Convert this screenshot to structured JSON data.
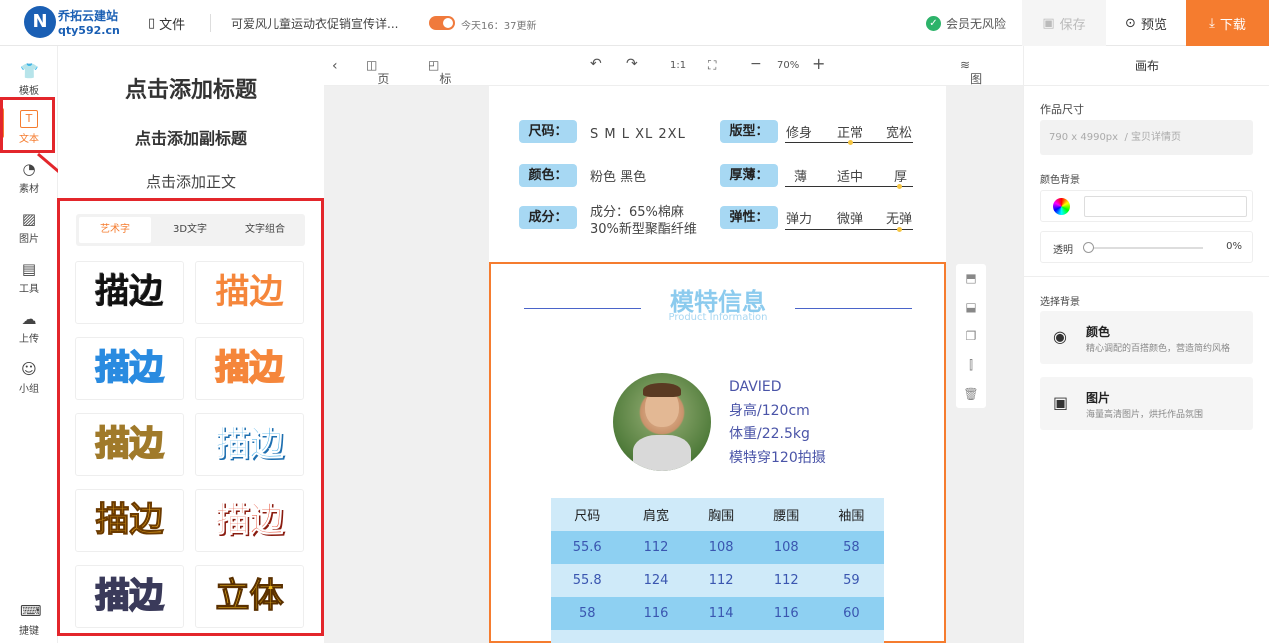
{
  "topbar": {
    "logo_name": "乔拓云建站",
    "logo_url": "qty592.cn",
    "file_label": "文件",
    "doc_title": "可爱风儿童运动衣促销宣传详...",
    "update_time": "今天16：37更新",
    "risk_label": "会员无风险",
    "save_label": "保存",
    "preview_label": "预览",
    "download_label": "下载"
  },
  "leftnav": {
    "items": [
      {
        "label": "模板",
        "icon": "template-icon"
      },
      {
        "label": "文本",
        "icon": "text-icon"
      },
      {
        "label": "素材",
        "icon": "material-icon"
      },
      {
        "label": "图片",
        "icon": "image-icon"
      },
      {
        "label": "工具",
        "icon": "tools-icon"
      },
      {
        "label": "上传",
        "icon": "upload-icon"
      },
      {
        "label": "小组",
        "icon": "group-icon"
      }
    ],
    "shortcut_label": "捷键"
  },
  "text_panel": {
    "add_title": "点击添加标题",
    "add_subtitle": "点击添加副标题",
    "add_body": "点击添加正文",
    "tabs": [
      "艺术字",
      "3D文字",
      "文字组合"
    ],
    "tiles": [
      "描边",
      "描边",
      "描边",
      "描边",
      "描边",
      "描边",
      "描边",
      "描边",
      "描边",
      "立体"
    ]
  },
  "canvas_toolbar": {
    "page_label": "页面",
    "ruler_label": "标尺",
    "ratio": "1:1",
    "zoom": "70%",
    "layers_label": "图层"
  },
  "spec": {
    "size_label": "尺码：",
    "size_value": "S M L XL 2XL",
    "fit_label": "版型：",
    "fit_options": [
      "修身",
      "正常",
      "宽松"
    ],
    "color_label": "颜色：",
    "color_value": "粉色 黑色",
    "thickness_label": "厚薄：",
    "thickness_options": [
      "薄",
      "适中",
      "厚"
    ],
    "material_label": "成分：",
    "material_value_1": "成分：65%棉麻",
    "material_value_2": "30%新型聚酯纤维",
    "elastic_label": "弹性：",
    "elastic_options": [
      "弹力",
      "微弹",
      "无弹"
    ]
  },
  "model": {
    "title": "模特信息",
    "subtitle": "Product Information",
    "name": "DAVIED",
    "height": "身高/120cm",
    "weight": "体重/22.5kg",
    "size_note": "模特穿120拍摄",
    "table_headers": [
      "尺码",
      "肩宽",
      "胸围",
      "腰围",
      "袖围"
    ],
    "table_rows": [
      [
        "55.6",
        "112",
        "108",
        "108",
        "58"
      ],
      [
        "55.8",
        "124",
        "112",
        "112",
        "59"
      ],
      [
        "58",
        "116",
        "114",
        "116",
        "60"
      ]
    ]
  },
  "right_panel": {
    "header": "画布",
    "size_label": "作品尺寸",
    "size_value": "790 x 4990px",
    "size_hint": "/ 宝贝详情页",
    "bg_color_label": "颜色背景",
    "opacity_label": "透明",
    "opacity_value": "0%",
    "choose_bg_label": "选择背景",
    "bg_options": [
      {
        "title": "颜色",
        "desc": "精心调配的百搭颜色，营造简约风格"
      },
      {
        "title": "图片",
        "desc": "海量高清图片，烘托作品氛围"
      }
    ]
  },
  "colors": {
    "accent": "#f57c2f",
    "brand": "#1a5fb4",
    "label_blue": "#a7d8f3",
    "table_blue": "#8ed0f2",
    "highlight_red": "#e3262b"
  }
}
